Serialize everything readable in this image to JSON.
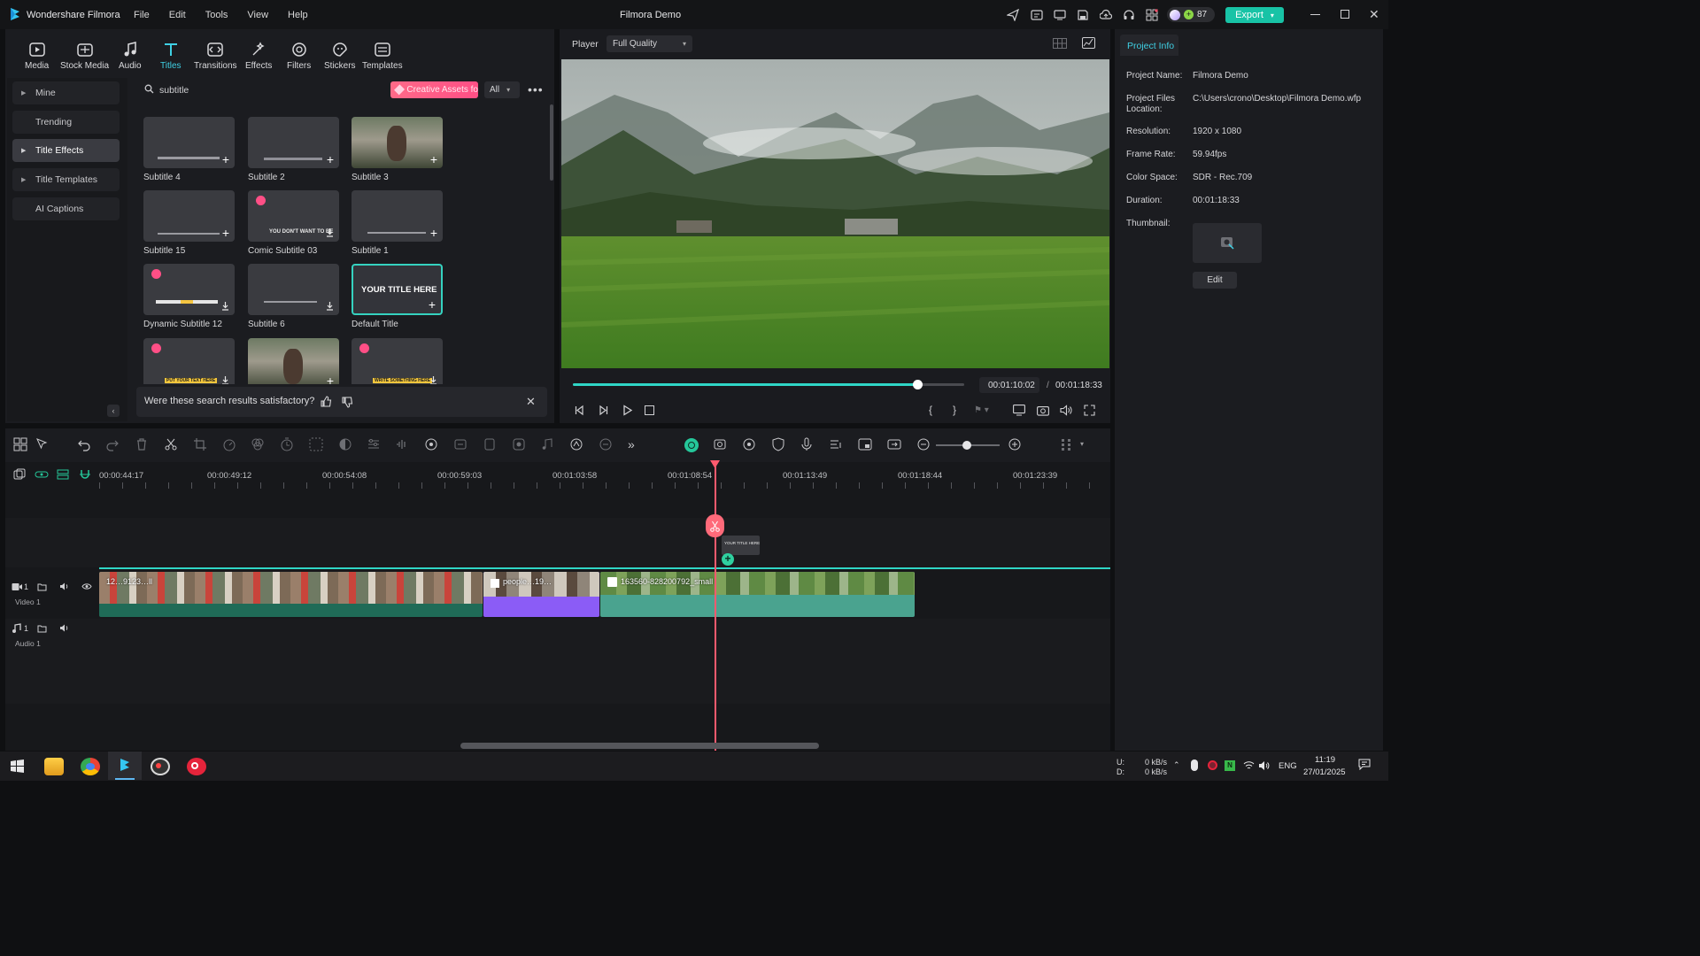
{
  "app": {
    "name": "Wondershare Filmora",
    "project_title": "Filmora Demo"
  },
  "menu": [
    "File",
    "Edit",
    "Tools",
    "View",
    "Help"
  ],
  "header": {
    "credits": "87",
    "export_label": "Export"
  },
  "toolbar": [
    "Media",
    "Stock Media",
    "Audio",
    "Titles",
    "Transitions",
    "Effects",
    "Filters",
    "Stickers",
    "Templates"
  ],
  "sidebar": {
    "items": [
      {
        "label": "Mine",
        "expandable": true,
        "active": false
      },
      {
        "label": "Trending",
        "expandable": false,
        "active": false
      },
      {
        "label": "Title Effects",
        "expandable": true,
        "active": true
      },
      {
        "label": "Title Templates",
        "expandable": true,
        "active": false
      },
      {
        "label": "AI Captions",
        "expandable": false,
        "active": false
      }
    ]
  },
  "search": {
    "value": "subtitle",
    "creative_assets": "Creative Assets fo",
    "filter": "All"
  },
  "titles": [
    {
      "label": "Subtitle 4",
      "premium": false,
      "action": "add"
    },
    {
      "label": "Subtitle 2",
      "premium": false,
      "action": "add"
    },
    {
      "label": "Subtitle 3",
      "premium": false,
      "action": "add"
    },
    {
      "label": "Subtitle 15",
      "premium": false,
      "action": "add"
    },
    {
      "label": "Comic Subtitle 03",
      "premium": true,
      "action": "download",
      "preview_text": "YOU DON'T WANT TO BE"
    },
    {
      "label": "Subtitle 1",
      "premium": false,
      "action": "add"
    },
    {
      "label": "Dynamic Subtitle 12",
      "premium": true,
      "action": "download"
    },
    {
      "label": "Subtitle 6",
      "premium": false,
      "action": "download"
    },
    {
      "label": "Default Title",
      "premium": false,
      "action": "add",
      "preview_text": "YOUR TITLE HERE",
      "selected": true
    },
    {
      "label": "",
      "premium": true,
      "action": "download",
      "preview_text": "PUT YOUR TEXT HERE"
    },
    {
      "label": "",
      "premium": false,
      "action": "add"
    },
    {
      "label": "",
      "premium": true,
      "action": "download",
      "preview_text": "WRITE SOMETHING HERE"
    }
  ],
  "feedback": {
    "question": "Were these search results satisfactory?"
  },
  "player": {
    "label": "Player",
    "quality": "Full Quality",
    "current_time": "00:01:10:02",
    "separator": "/",
    "total_time": "00:01:18:33",
    "progress": 0.88
  },
  "project_info": {
    "tab": "Project Info",
    "rows": [
      {
        "label": "Project Name:",
        "value": "Filmora Demo"
      },
      {
        "label": "Project Files Location:",
        "value": "C:\\Users\\crono\\Desktop\\Filmora Demo.wfp"
      },
      {
        "label": "Resolution:",
        "value": "1920 x 1080"
      },
      {
        "label": "Frame Rate:",
        "value": "59.94fps"
      },
      {
        "label": "Color Space:",
        "value": "SDR - Rec.709"
      },
      {
        "label": "Duration:",
        "value": "00:01:18:33"
      },
      {
        "label": "Thumbnail:",
        "value": ""
      }
    ],
    "edit_label": "Edit"
  },
  "timeline": {
    "ruler": [
      "00:00:44:17",
      "00:00:49:12",
      "00:00:54:08",
      "00:00:59:03",
      "00:01:03:58",
      "00:01:08:54",
      "00:01:13:49",
      "00:01:18:44",
      "00:01:23:39"
    ],
    "drag_preview": "YOUR TITLE HERE",
    "tracks": [
      {
        "name": "Video 1",
        "index": "1"
      },
      {
        "name": "Audio 1",
        "index": "1"
      }
    ],
    "clips": [
      {
        "name": "12…9123…ll",
        "color": "#1f6b57"
      },
      {
        "name": "people…19…",
        "color": "#8b5cf6"
      },
      {
        "name": "163560-828200792_small",
        "color": "#4aa38f"
      }
    ]
  },
  "taskbar": {
    "net_up": "0 kB/s",
    "net_down": "0 kB/s",
    "net_up_label": "U:",
    "net_down_label": "D:",
    "lang": "ENG",
    "time": "11:19",
    "date": "27/01/2025"
  }
}
